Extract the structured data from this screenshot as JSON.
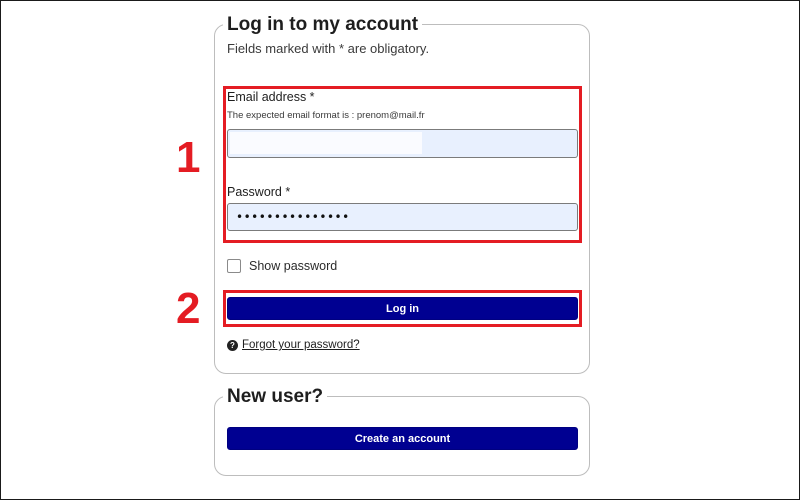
{
  "login": {
    "title": "Log in to my account",
    "hint": "Fields marked with * are obligatory.",
    "email_label": "Email address *",
    "email_hint": "The expected email format is : prenom@mail.fr",
    "email_value": "",
    "password_label": "Password *",
    "password_value": "•••••••••••••••",
    "show_password_label": "Show password",
    "login_button": "Log in",
    "forgot_password": "Forgot your password?",
    "help_icon": "question-circle-icon"
  },
  "new_user": {
    "title": "New user?",
    "create_button": "Create an account"
  },
  "annotations": {
    "step1": "1",
    "step2": "2",
    "highlight_color": "#e41c23"
  },
  "colors": {
    "primary_button": "#000091",
    "input_autofill_bg": "#e8f0fe"
  }
}
